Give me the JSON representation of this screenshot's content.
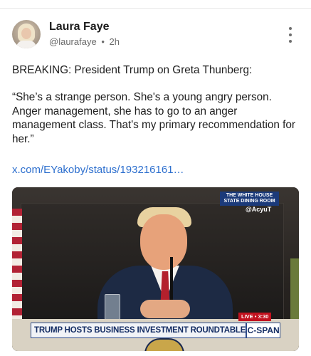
{
  "post": {
    "author_name": "Laura Faye",
    "author_handle": "@laurafaye",
    "time": "2h",
    "meta_separator": "•",
    "headline": "BREAKING: President Trump on Greta Thunberg:",
    "quote": "“She’s a strange person. She's a young angry person. Anger management, she has to go to an anger management class. That's my primary recommendation for her.”",
    "link_text": "x.com/EYakoby/status/193216161…"
  },
  "media": {
    "location_tag": "THE WHITE HOUSE STATE DINING ROOM",
    "watermark": "@AcyuT",
    "live_label": "LIVE • 3:30",
    "chyron": "TRUMP HOSTS BUSINESS INVESTMENT ROUNDTABLE",
    "network": "C-SPAN"
  },
  "icons": {
    "more": "more-vertical-icon"
  },
  "colors": {
    "link": "#2d6fce",
    "chyron_blue": "#142d64"
  }
}
